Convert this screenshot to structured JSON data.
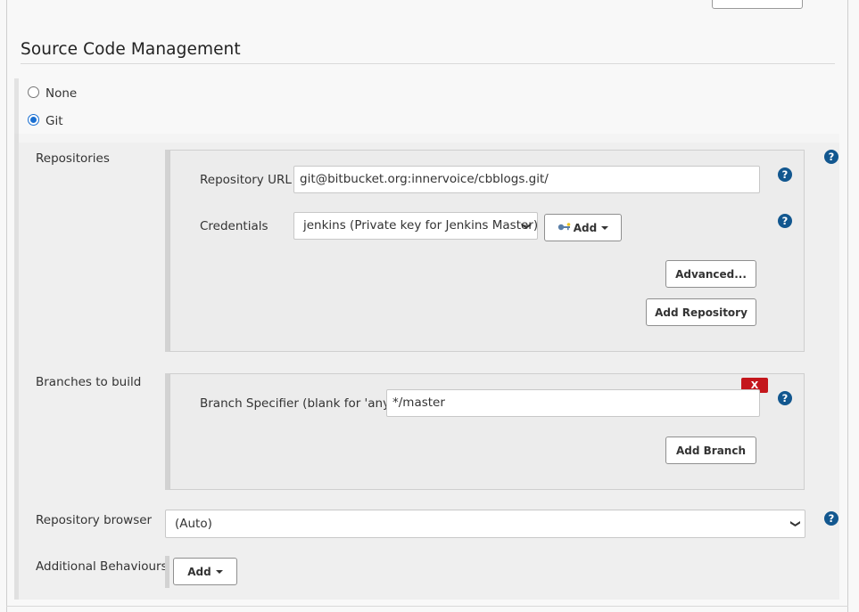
{
  "section": {
    "title": "Source Code Management"
  },
  "scm_options": {
    "none_label": "None",
    "git_label": "Git",
    "selected": "Git"
  },
  "repositories": {
    "label": "Repositories",
    "url_label": "Repository URL",
    "url_value": "git@bitbucket.org:innervoice/cbblogs.git/",
    "credentials_label": "Credentials",
    "credentials_value": "jenkins (Private key for Jenkins Master)",
    "add_label": "Add",
    "advanced_label": "Advanced...",
    "add_repository_label": "Add Repository"
  },
  "branches": {
    "label": "Branches to build",
    "specifier_label": "Branch Specifier (blank for 'any')",
    "specifier_value": "*/master",
    "delete_label": "X",
    "add_branch_label": "Add Branch"
  },
  "repository_browser": {
    "label": "Repository browser",
    "value": "(Auto)"
  },
  "additional_behaviours": {
    "label": "Additional Behaviours",
    "add_label": "Add"
  },
  "help": {
    "glyph": "?"
  },
  "colors": {
    "help_icon": "#12578f",
    "radio_accent": "#1a6fd1",
    "delete_button": "#c4161c"
  }
}
